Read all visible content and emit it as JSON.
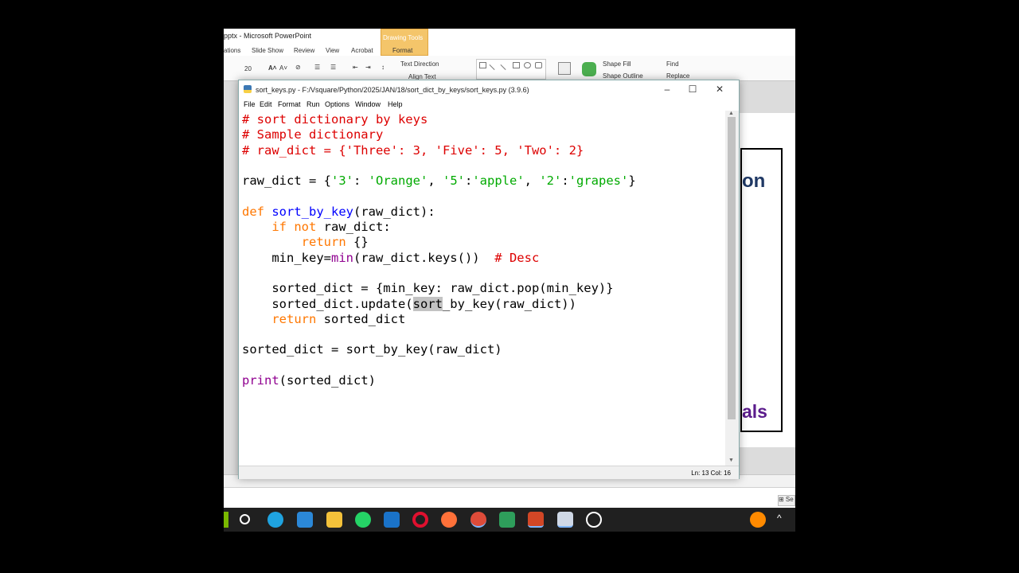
{
  "powerpoint": {
    "title": "pptx - Microsoft PowerPoint",
    "drawing_tools": "Drawing Tools",
    "tabs": [
      "ations",
      "Slide Show",
      "Review",
      "View",
      "Acrobat",
      "Format"
    ],
    "font_size": "20",
    "text_direction": "Text Direction",
    "align_text": "Align Text",
    "shape_fill": "Shape Fill",
    "shape_outline": "Shape Outline",
    "find": "Find",
    "replace": "Replace",
    "slide_text_top": "on",
    "slide_text_bottom": "als"
  },
  "idle": {
    "title": "sort_keys.py - F:/Vsquare/Python/2025/JAN/18/sort_dict_by_keys/sort_keys.py (3.9.6)",
    "menu": [
      "File",
      "Edit",
      "Format",
      "Run",
      "Options",
      "Window",
      "Help"
    ],
    "window_controls": {
      "minimize": "–",
      "maximize": "☐",
      "close": "✕"
    },
    "status": "Ln: 13   Col: 16",
    "code": {
      "l1": "# sort dictionary by keys",
      "l2": "# Sample dictionary",
      "l3": "# raw_dict = {'Three': 3, 'Five': 5, 'Two': 2}",
      "l5a": "raw_dict = {",
      "l5s1": "'3'",
      "l5s2": "'Orange'",
      "l5s3": "'5'",
      "l5s4": "'apple'",
      "l5s5": "'2'",
      "l5s6": "'grapes'",
      "l7_def": "def",
      "l7_name": "sort_by_key",
      "l7_rest": "(raw_dict):",
      "l8_if": "if",
      "l8_not": "not",
      "l8_rest": " raw_dict:",
      "l9_ret": "return",
      "l9_rest": " {}",
      "l10a": "min_key=",
      "l10_min": "min",
      "l10b": "(raw_dict.keys())  ",
      "l10_cm": "# Desc",
      "l12": "sorted_dict = {min_key: raw_dict.pop(min_key)}",
      "l13a": "sorted_dict.update(",
      "l13_sel": "sort",
      "l13b": "_by_key(raw_dict))",
      "l14_ret": "return",
      "l14_rest": " sorted_dict",
      "l16": "sorted_dict = sort_by_key(raw_dict)",
      "l18_print": "print",
      "l18_rest": "(sorted_dict)"
    }
  },
  "taskbar": {
    "icons": [
      "search-circle",
      "edge",
      "store",
      "file-explorer",
      "whatsapp",
      "mail",
      "opera",
      "firefox",
      "chrome",
      "android",
      "powerpoint",
      "idle",
      "clock-app"
    ],
    "colors": {
      "edge": "#1fa3e0",
      "store": "#2b88d8",
      "explorer": "#f3c13a",
      "whatsapp": "#25d366",
      "mail": "#1a73c9",
      "opera": "#e0102f",
      "firefox": "#ff7139",
      "chrome": "#dd4b39",
      "android": "#2e9e5b",
      "powerpoint": "#d24726",
      "idle": "#cfd8e6",
      "clock": "#e03030",
      "ubuntu": "#ff8a00"
    }
  }
}
